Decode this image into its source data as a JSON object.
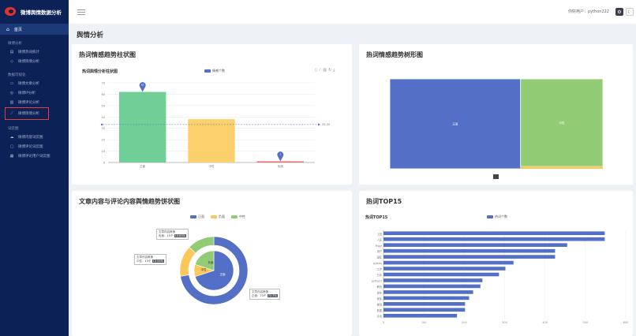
{
  "app": {
    "brand_title": "微博舆情数据分析",
    "nav_home": "首页",
    "sections": [
      {
        "title": "微博分析",
        "items": [
          "微博热词统计",
          "微博舆情分析"
        ]
      },
      {
        "title": "数据可视化",
        "items": [
          "微博文章分析",
          "微博IP分析",
          "微博评论分析",
          "微博舆情分析"
        ]
      },
      {
        "title": "词云图",
        "items": [
          "微博内容词云图",
          "微博评论词云图",
          "微博评论用户词云图"
        ]
      }
    ],
    "highlighted_item": "微博舆情分析"
  },
  "topbar": {
    "user_label": "你好用户：python222",
    "gear_icon": "gear-icon",
    "moon_icon": "moon-icon"
  },
  "page_title": "舆情分析",
  "colors": {
    "sidebar": "#0c2156",
    "green": "#6fcf97",
    "yellow": "#fcd06a",
    "red": "#ee6666",
    "blue": "#5470c6",
    "accent_red": "#e23e3e"
  },
  "cards": {
    "bar_card": {
      "title": "热词情感趋势柱状图",
      "subtitle": "热词舆情分析柱状图",
      "legend": "情感个数",
      "avg_label": "33.33"
    },
    "treemap_card": {
      "title": "热词情感趋势树形图",
      "labels": [
        "正面",
        "中性"
      ]
    },
    "pie_card": {
      "title": "文章内容与评论内容舆情趋势饼状图",
      "legend": [
        "正面",
        "负面",
        "中性"
      ],
      "tooltips": [
        {
          "title": "文章内容舆情",
          "name": "负面",
          "value": "15个",
          "pct": "15.63%"
        },
        {
          "title": "文章内容舆情",
          "name": "中性",
          "value": "13个",
          "pct": "13.54%"
        },
        {
          "title": "文章内容舆情",
          "name": "正面",
          "value": "73个",
          "pct": "72.7%"
        }
      ],
      "inner_labels": [
        "正面",
        "中性",
        "负面"
      ]
    },
    "top15_card": {
      "title": "热词TOP15",
      "subtitle": "热词TOP15",
      "legend": "热词个数"
    }
  },
  "chart_data": [
    {
      "type": "bar",
      "title": "热词舆情分析柱状图",
      "series": [
        {
          "name": "情感个数",
          "values": [
            62,
            38,
            1
          ]
        }
      ],
      "categories": [
        "正面",
        "中性",
        "负面"
      ],
      "colors": [
        "#6fcf97",
        "#fcd06a",
        "#ee6666"
      ],
      "ylim": [
        0,
        70
      ],
      "yticks": [
        0,
        10,
        20,
        30,
        40,
        50,
        60,
        70
      ],
      "markers": [
        {
          "category": "正面",
          "label": "62"
        },
        {
          "category": "负面",
          "label": "1"
        }
      ],
      "mean_line": 33.33,
      "grid": true,
      "legend": "top-center"
    },
    {
      "type": "treemap",
      "title": "",
      "items": [
        {
          "name": "正面",
          "value": 62,
          "color": "#5470c6"
        },
        {
          "name": "中性",
          "value": 38,
          "color": "#91cc75"
        },
        {
          "name": "负面",
          "value": 1,
          "color": "#fac858"
        }
      ]
    },
    {
      "type": "pie",
      "title": "",
      "legend": "top-center",
      "outer": {
        "name": "评论内容舆情",
        "slices": [
          {
            "name": "正面",
            "value": 73,
            "color": "#5470c6"
          },
          {
            "name": "负面",
            "value": 15,
            "color": "#fac858"
          },
          {
            "name": "中性",
            "value": 13,
            "color": "#91cc75"
          }
        ]
      },
      "inner": {
        "name": "文章内容舆情",
        "slices": [
          {
            "name": "正面",
            "value": 70,
            "color": "#5470c6"
          },
          {
            "name": "负面",
            "value": 10,
            "color": "#fac858"
          },
          {
            "name": "中性",
            "value": 20,
            "color": "#91cc75"
          }
        ]
      }
    },
    {
      "type": "bar",
      "orientation": "horizontal",
      "title": "热词TOP15",
      "series": [
        {
          "name": "热词个数",
          "values": [
            548,
            548,
            455,
            425,
            425,
            322,
            302,
            286,
            245,
            240,
            222,
            212,
            202,
            202,
            182
          ]
        }
      ],
      "categories": [
        "上班",
        "人员",
        "Progr",
        "用户",
        "国际",
        "python",
        "工作",
        "日本",
        "python1",
        "教育",
        "发布",
        "程序",
        "微博",
        "数据",
        "环境"
      ],
      "xlim": [
        0,
        600
      ],
      "xticks": [
        0,
        100,
        200,
        300,
        400,
        500,
        600
      ],
      "color": "#5470c6",
      "legend": "top-center"
    }
  ]
}
